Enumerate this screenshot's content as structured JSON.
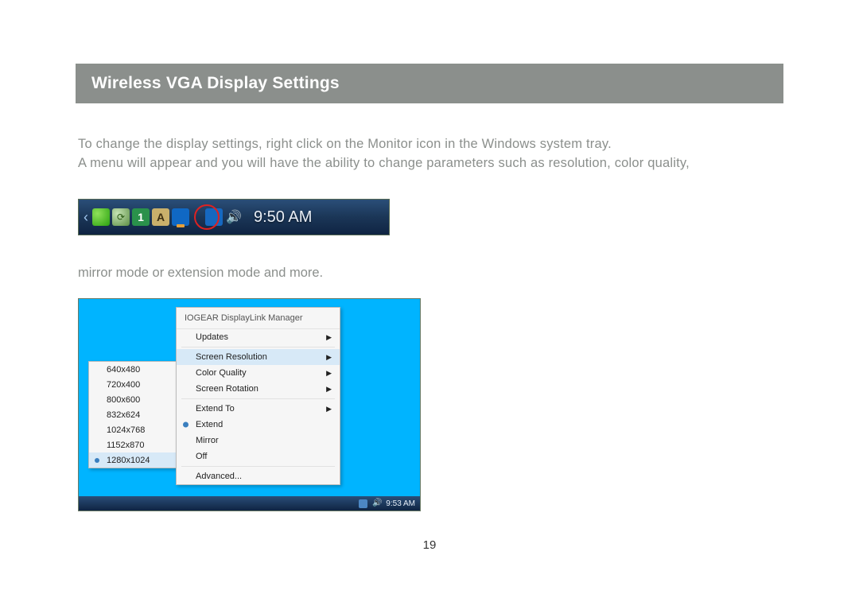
{
  "header": {
    "title": "Wireless VGA Display Settings"
  },
  "body": {
    "para_line1": "To change the display settings, right click on the Monitor icon in the Windows system tray.",
    "para_line2": "A menu will appear and you will have the ability to change parameters such as resolution, color quality,",
    "continuation": "mirror mode or extension mode and more."
  },
  "tray": {
    "chevron": "‹",
    "icon_one_label": "1",
    "icon_a_label": "A",
    "volume_glyph": "🔊",
    "clock": "9:50 AM"
  },
  "menu": {
    "header": "IOGEAR DisplayLink Manager",
    "items": {
      "updates": "Updates",
      "screen_resolution": "Screen Resolution",
      "color_quality": "Color Quality",
      "screen_rotation": "Screen Rotation",
      "extend_to": "Extend To",
      "extend": "Extend",
      "mirror": "Mirror",
      "off": "Off",
      "advanced": "Advanced..."
    },
    "arrow_glyph": "▶",
    "resolutions": [
      "640x480",
      "720x400",
      "800x600",
      "832x624",
      "1024x768",
      "1152x870",
      "1280x1024"
    ],
    "taskbar_clock": "9:53 AM",
    "taskbar_volume_glyph": "🔊"
  },
  "page_number": "19"
}
